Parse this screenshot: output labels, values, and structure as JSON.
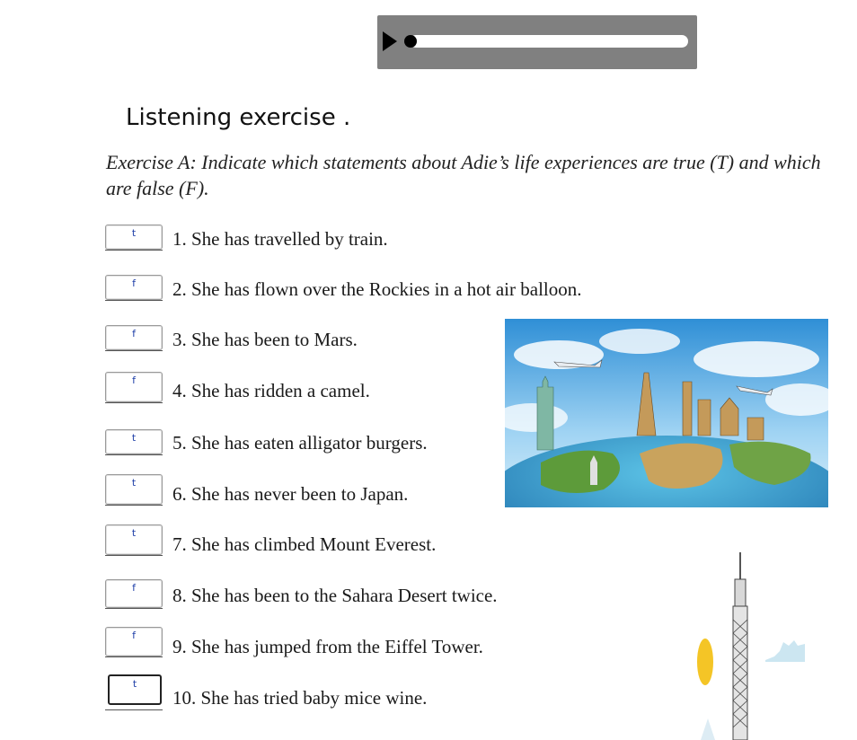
{
  "audio_player": {
    "play_icon": "play-icon",
    "progress": 0.0
  },
  "heading": "Listening exercise .",
  "instructions": "Exercise A: Indicate which statements about Adie’s life experiences are true (T) and which are false (F).",
  "items": [
    {
      "answer": "t",
      "text": "1.  She has travelled by train."
    },
    {
      "answer": "f",
      "text": "2.  She has flown over the Rockies in a hot air balloon."
    },
    {
      "answer": "f",
      "text": "3.  She has been to Mars."
    },
    {
      "answer": "f",
      "text": "4.  She has ridden a camel."
    },
    {
      "answer": "t",
      "text": "5.  She has eaten alligator burgers."
    },
    {
      "answer": "t",
      "text": "6.  She has never been to Japan."
    },
    {
      "answer": "t",
      "text": "7.  She has climbed Mount Everest."
    },
    {
      "answer": "f",
      "text": "8.  She has been to the Sahara Desert twice."
    },
    {
      "answer": "f",
      "text": "9.  She has jumped from the Eiffel Tower."
    },
    {
      "answer": "t",
      "text": "10. She has tried baby mice wine."
    }
  ],
  "colors": {
    "player_bg": "#808080",
    "answer_text": "#1f3fa8"
  }
}
